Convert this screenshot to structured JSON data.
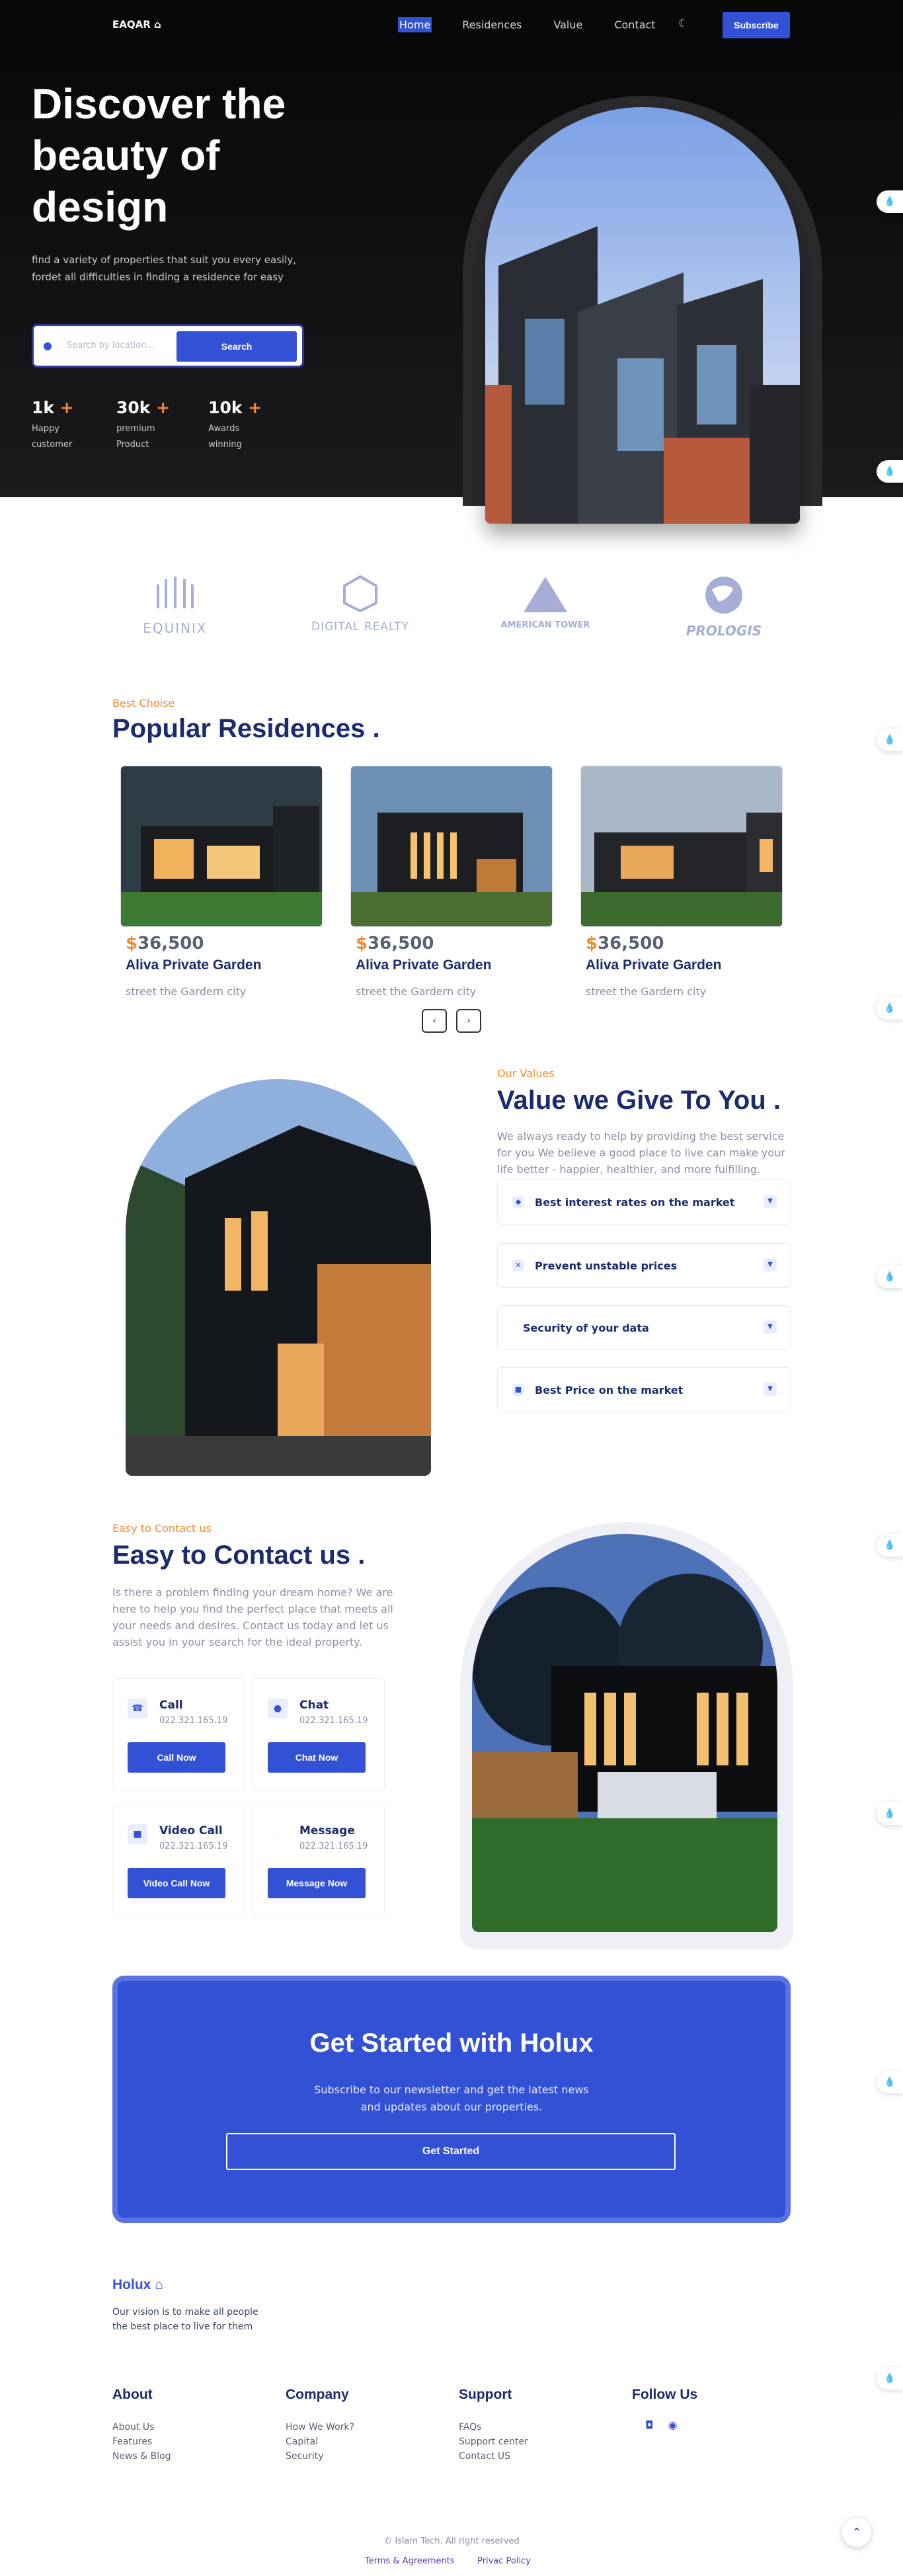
{
  "nav": {
    "logo": "EAQAR",
    "links": [
      "Home",
      "Residences",
      "Value",
      "Contact"
    ],
    "subscribe": "Subscribe"
  },
  "hero": {
    "title": "Discover the beauty of design",
    "subtitle": "find a variety of properties that suit you every easily, fordet all difficulties in finding a residence for easy",
    "search_placeholder": "Search by location...",
    "search_button": "Search",
    "stats": [
      {
        "num": "1k",
        "plus": "+",
        "label": "Happy customer"
      },
      {
        "num": "30k",
        "plus": "+",
        "label": "premium Product"
      },
      {
        "num": "10k",
        "plus": "+",
        "label": "Awards winning"
      }
    ]
  },
  "brands": [
    "EQUINIX",
    "DIGITAL REALTY",
    "AMERICAN TOWER",
    "PROLOGIS"
  ],
  "residences": {
    "kicker": "Best Choise",
    "title": "Popular Residences .",
    "cards": [
      {
        "currency": "$",
        "price": "36,500",
        "name": "Aliva Private Garden",
        "address": "street the Gardern city"
      },
      {
        "currency": "$",
        "price": "36,500",
        "name": "Aliva Private Garden",
        "address": "street the Gardern city"
      },
      {
        "currency": "$",
        "price": "36,500",
        "name": "Aliva Private Garden",
        "address": "street the Gardern city"
      }
    ]
  },
  "values": {
    "kicker": "Our Values",
    "title": "Value we Give To You .",
    "text": "We always ready to help by providing the best service for you We believe a good place to live can make your life better - happier, healthier, and more fulfilling.",
    "items": [
      "Best interest rates on the market",
      "Prevent unstable prices",
      "Security of your data",
      "Best Price on the market"
    ]
  },
  "contact": {
    "kicker": "Easy to Contact us",
    "title": "Easy to Contact us .",
    "text": "Is there a problem finding your dream home? We are here to help you find the perfect place that meets all your needs and desires. Contact us today and let us assist you in your search for the ideal property.",
    "cards": [
      {
        "title": "Call",
        "number": "022.321.165.19",
        "button": "Call Now"
      },
      {
        "title": "Chat",
        "number": "022.321.165.19",
        "button": "Chat Now"
      },
      {
        "title": "Video Call",
        "number": "022.321.165.19",
        "button": "Video Call Now"
      },
      {
        "title": "Message",
        "number": "022.321.165.19",
        "button": "Message Now"
      }
    ]
  },
  "cta": {
    "title": "Get Started with Holux",
    "text": "Subscribe to our newsletter and get the latest news and updates about our properties.",
    "button": "Get Started"
  },
  "footer": {
    "brand": "Holux",
    "vision": "Our vision is to make all people the best place to live for them",
    "columns": [
      {
        "title": "About",
        "links": [
          "About Us",
          "Features",
          "News & Blog"
        ]
      },
      {
        "title": "Company",
        "links": [
          "How We Work?",
          "Capital",
          "Security"
        ]
      },
      {
        "title": "Support",
        "links": [
          "FAQs",
          "Support center",
          "Contact US"
        ]
      }
    ],
    "follow": "Follow Us",
    "copyright": "© Islam Tech. All right reserved",
    "terms": "Terms & Agreements",
    "privacy": "Privac Policy"
  },
  "colors": {
    "primary": "#3351d4",
    "accent": "#f28a2a",
    "navy": "#1c2b6e"
  }
}
